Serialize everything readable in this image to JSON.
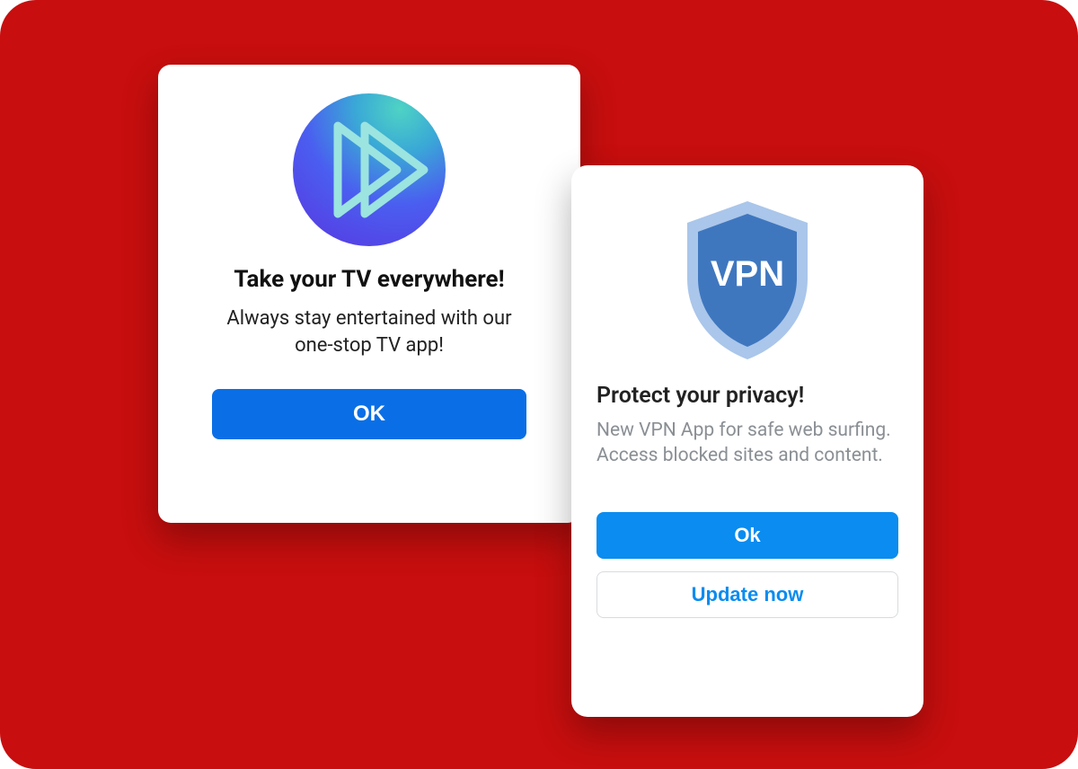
{
  "stage": {
    "bg": "#c80e0e"
  },
  "tv_dialog": {
    "title": "Take your TV everywhere!",
    "body_line1": "Always stay entertained with our",
    "body_line2": "one-stop TV app!",
    "ok_label": "OK",
    "icon_name": "double-play-icon"
  },
  "vpn_dialog": {
    "shield_text": "VPN",
    "title": "Protect your privacy!",
    "body": "New VPN App for safe web surfing. Access blocked sites and content.",
    "ok_label": "Ok",
    "update_label": "Update now",
    "icon_name": "vpn-shield-icon"
  }
}
